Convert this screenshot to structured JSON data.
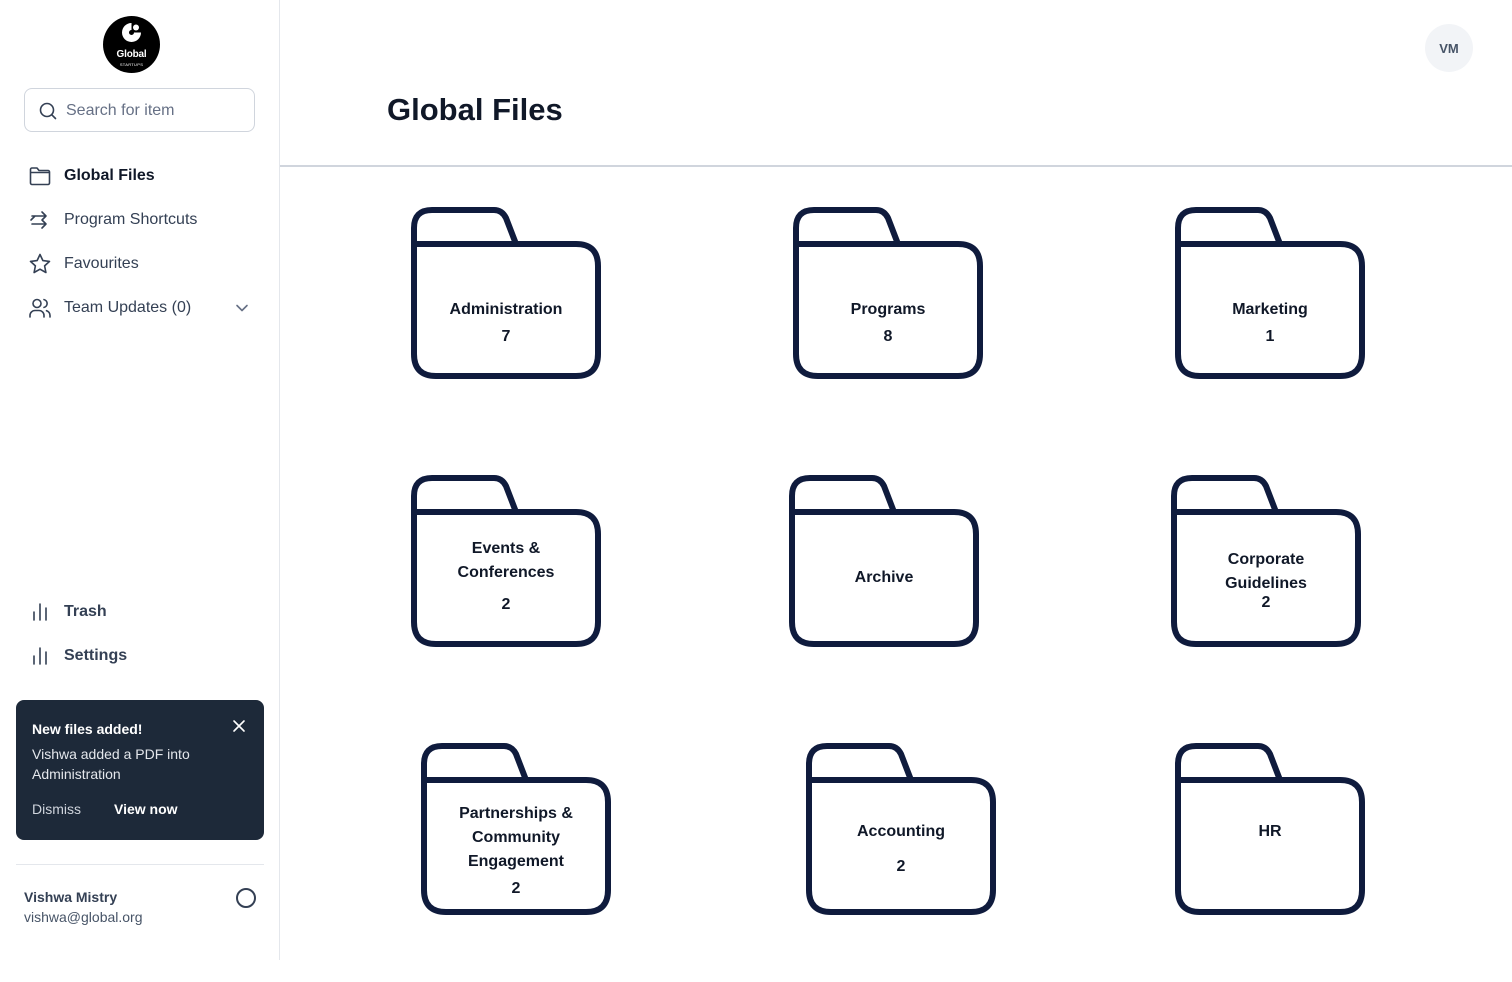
{
  "logo": {
    "text": "Global",
    "subtext": "STARTUPS"
  },
  "search": {
    "placeholder": "Search for item"
  },
  "nav": {
    "global_files": "Global Files",
    "program_shortcuts": "Program Shortcuts",
    "favourites": "Favourites",
    "team_updates": "Team Updates (0)",
    "trash": "Trash",
    "settings": "Settings"
  },
  "toast": {
    "title": "New files added!",
    "body": "Vishwa added a PDF into Administration",
    "dismiss": "Dismiss",
    "view_now": "View now"
  },
  "user": {
    "name": "Vishwa Mistry",
    "email": "vishwa@global.org",
    "initials": "VM"
  },
  "page": {
    "title": "Global Files"
  },
  "folders": [
    {
      "name": "Administration",
      "count": "7"
    },
    {
      "name": "Programs",
      "count": "8"
    },
    {
      "name": "Marketing",
      "count": "1"
    },
    {
      "name_line1": "Events &",
      "name_line2": "Conferences",
      "count": "2"
    },
    {
      "name": "Archive"
    },
    {
      "name_line1": "Corporate",
      "name_line2": "Guidelines",
      "count": "2"
    },
    {
      "name_line1": "Partnerships &",
      "name_line2": "Community",
      "name_line3": "Engagement",
      "count": "2"
    },
    {
      "name": "Accounting",
      "count": "2"
    },
    {
      "name": "HR"
    }
  ],
  "colors": {
    "folder_stroke": "#0f1b3d",
    "toast_bg": "#1d2939",
    "divider": "#d0d5dd"
  }
}
